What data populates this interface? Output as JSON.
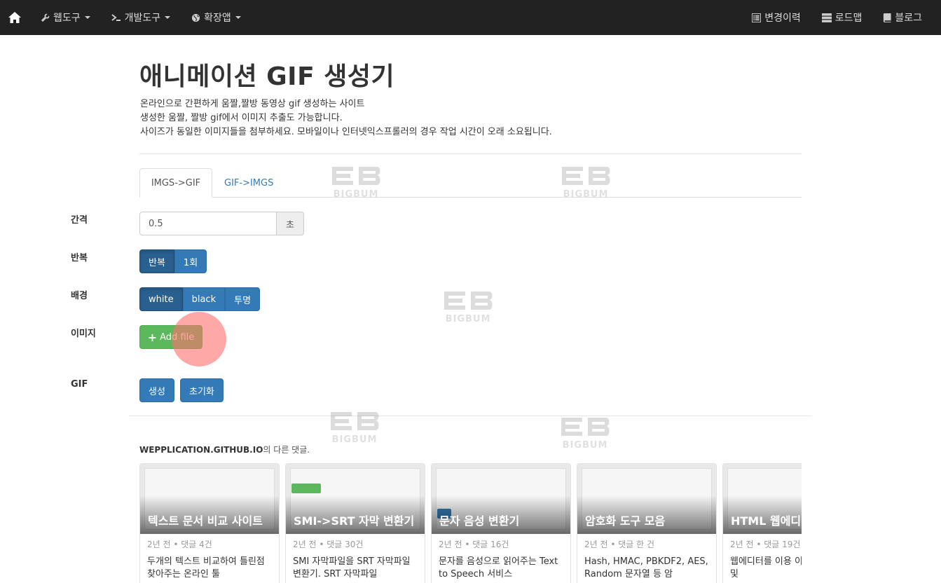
{
  "nav": {
    "left": [
      {
        "icon": "wrench-icon",
        "label": "웹도구"
      },
      {
        "icon": "terminal-icon",
        "label": "개발도구"
      },
      {
        "icon": "globe-icon",
        "label": "확장앱"
      }
    ],
    "right": [
      {
        "icon": "list-icon",
        "label": "변경이력"
      },
      {
        "icon": "server-icon",
        "label": "로드맵"
      },
      {
        "icon": "book-icon",
        "label": "블로그"
      }
    ]
  },
  "page": {
    "title": "애니메이션 GIF 생성기",
    "desc": [
      "온라인으로 간편하게 움짤,짤방 동영상 gif 생성하는 사이트",
      "생성한 움짤, 짤방 gif에서 이미지 추출도 가능합니다.",
      "사이즈가 동일한 이미지들을 첨부하세요. 모바일이나 인터넷익스프롤러의 경우 작업 시간이 오래 소요됩니다."
    ]
  },
  "tabs": [
    "IMGS->GIF",
    "GIF->IMGS"
  ],
  "form": {
    "interval": {
      "label": "간격",
      "value": "0.5",
      "unit": "초"
    },
    "repeat": {
      "label": "반복",
      "options": [
        "반복",
        "1회"
      ],
      "selected": "반복"
    },
    "background": {
      "label": "배경",
      "options": [
        "white",
        "black",
        "투명"
      ],
      "selected": "white"
    },
    "image": {
      "label": "이미지",
      "add_button": "Add file"
    },
    "gif": {
      "label": "GIF",
      "create": "생성",
      "reset": "초기화"
    }
  },
  "comments": {
    "site": "WEPPLICATION.GITHUB.IO",
    "suffix": "의 다른 댓글.",
    "cards": [
      {
        "title": "텍스트 문서 비교 사이트",
        "meta": "2년 전 • 댓글 4건",
        "snippet": "두개의 텍스트 비교하여 틀린점 찾아주는 온라인 툴"
      },
      {
        "title": "SMI->SRT 자막 변환기",
        "meta": "2년 전 • 댓글 30건",
        "snippet": "SMI 자막파일을 SRT 자막파일 변환기. SRT 자막파일"
      },
      {
        "title": "문자 음성 변환기",
        "meta": "2년 전 • 댓글 16건",
        "snippet": "문자를 음성으로 읽어주는 Text to Speech 서비스"
      },
      {
        "title": "암호화 도구 모음",
        "meta": "2년 전 • 댓글 한 건",
        "snippet": "Hash, HMAC, PBKDF2, AES, Random 문자열 등 암"
      },
      {
        "title": "HTML 웹에디터",
        "meta": "2년 전 • 댓글 19건",
        "snippet": "웹에디터를 이용 이미지 합치기 및"
      }
    ]
  },
  "watermark": "BIGBUM"
}
